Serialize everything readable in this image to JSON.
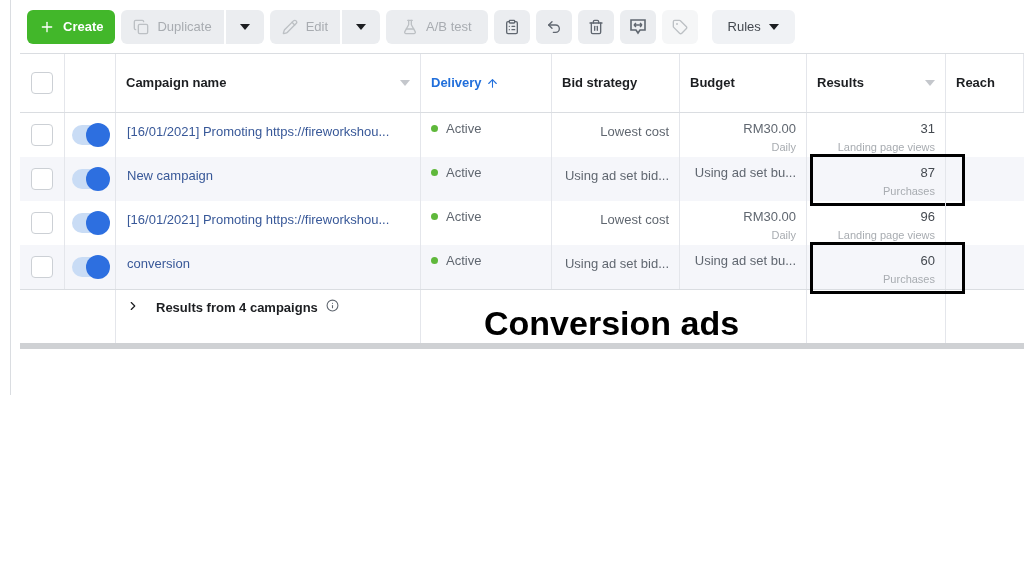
{
  "toolbar": [
    {
      "kind": "create",
      "label": "Create",
      "disabled": false
    },
    {
      "kind": "split",
      "label": "Duplicate",
      "disabled": true
    },
    {
      "kind": "split",
      "label": "Edit",
      "disabled": true
    },
    {
      "kind": "text",
      "label": "A/B test",
      "disabled": true
    },
    {
      "kind": "icon",
      "disabled": false
    },
    {
      "kind": "icon",
      "disabled": false
    },
    {
      "kind": "icon",
      "disabled": false
    },
    {
      "kind": "icon",
      "disabled": false
    },
    {
      "kind": "icon",
      "disabled": true
    },
    {
      "kind": "menu",
      "label": "Rules",
      "disabled": false
    }
  ],
  "table": {
    "select_all": {
      "checked": false
    },
    "columns": [
      {
        "label": "Campaign name",
        "sorted": false,
        "menu": true
      },
      {
        "label": "Delivery",
        "sorted": true,
        "menu": false
      },
      {
        "label": "Bid strategy",
        "sorted": false,
        "menu": false
      },
      {
        "label": "Budget",
        "sorted": false,
        "menu": false
      },
      {
        "label": "Results",
        "sorted": false,
        "menu": true
      },
      {
        "label": "Reach",
        "sorted": false,
        "menu": false
      }
    ],
    "rows": [
      {
        "checked": false,
        "on": true,
        "name": "[16/01/2021] Promoting https://fireworkshou...",
        "delivery": "Active",
        "bid_strategy": "Lowest cost",
        "budget": "RM30.00",
        "budget_note": "Daily",
        "result": "31",
        "result_type": "Landing page views",
        "highlighted": false
      },
      {
        "checked": false,
        "on": true,
        "name": "New campaign",
        "delivery": "Active",
        "bid_strategy": "Using ad set bid...",
        "budget": "Using ad set bu...",
        "result": "87",
        "result_type": "Purchases",
        "highlighted": true
      },
      {
        "checked": false,
        "on": true,
        "name": "[16/01/2021] Promoting https://fireworkshou...",
        "delivery": "Active",
        "bid_strategy": "Lowest cost",
        "budget": "RM30.00",
        "budget_note": "Daily",
        "result": "96",
        "result_type": "Landing page views",
        "highlighted": false
      },
      {
        "checked": false,
        "on": true,
        "name": "conversion",
        "delivery": "Active",
        "bid_strategy": "Using ad set bid...",
        "budget": "Using ad set bu...",
        "result": "60",
        "result_type": "Purchases",
        "highlighted": true
      }
    ],
    "summary": "Results from 4 campaigns"
  },
  "annotation": {
    "text": "Conversion ads"
  }
}
